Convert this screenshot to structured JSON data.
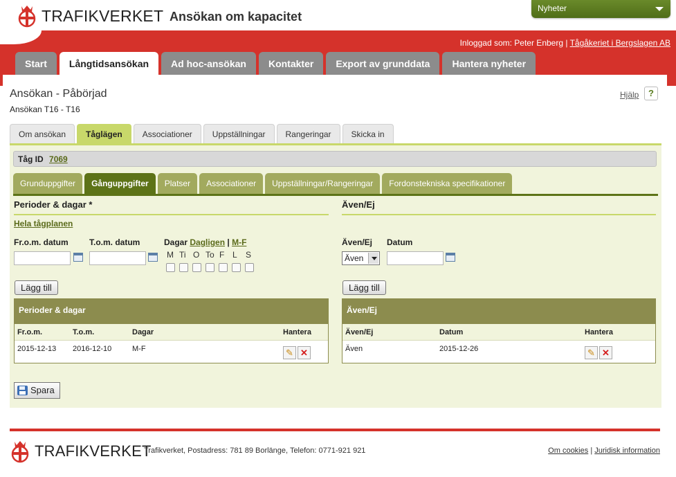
{
  "header": {
    "logo_text": "TRAFIKVERKET",
    "app_title": "Ansökan om kapacitet",
    "news_label": "Nyheter"
  },
  "login": {
    "prefix": "Inloggad som: Peter Enberg | ",
    "company": "Tågåkeriet i Bergslagen AB"
  },
  "main_tabs": [
    "Start",
    "Långtidsansökan",
    "Ad hoc-ansökan",
    "Kontakter",
    "Export av grunddata",
    "Hantera nyheter"
  ],
  "page": {
    "title": "Ansökan - Påbörjad",
    "subtitle": "Ansökan T16 - T16",
    "help_label": "Hjälp",
    "help_icon": "?"
  },
  "sub_tabs": [
    "Om ansökan",
    "Tåglägen",
    "Associationer",
    "Uppställningar",
    "Rangeringar",
    "Skicka in"
  ],
  "train": {
    "label": "Tåg ID",
    "id": "7069"
  },
  "inner_tabs": [
    "Grunduppgifter",
    "Gånguppgifter",
    "Platser",
    "Associationer",
    "Uppställningar/Rangeringar",
    "Fordonstekniska specifikationer"
  ],
  "periods": {
    "section_title": "Perioder & dagar *",
    "whole_plan_link": "Hela tågplanen",
    "from_label": "Fr.o.m. datum",
    "to_label": "T.o.m. datum",
    "days_label": "Dagar",
    "daily_link": "Dagligen",
    "separator": "|",
    "weekday_link": "M-F",
    "day_letters": [
      "M",
      "Ti",
      "O",
      "To",
      "F",
      "L",
      "S"
    ],
    "add_button": "Lägg till",
    "grid_title": "Perioder & dagar",
    "columns": [
      "Fr.o.m.",
      "T.o.m.",
      "Dagar",
      "Hantera"
    ],
    "rows": [
      {
        "from": "2015-12-13",
        "to": "2016-12-10",
        "days": "M-F"
      }
    ]
  },
  "also": {
    "section_title": "Även/Ej",
    "type_label": "Även/Ej",
    "date_label": "Datum",
    "type_value": "Även",
    "add_button": "Lägg till",
    "grid_title": "Även/Ej",
    "columns": [
      "Även/Ej",
      "Datum",
      "Hantera"
    ],
    "rows": [
      {
        "type": "Även",
        "date": "2015-12-26"
      }
    ]
  },
  "save_button": "Spara",
  "footer": {
    "logo_text": "TRAFIKVERKET",
    "address": "Trafikverket, Postadress: 781 89 Borlänge, Telefon: 0771-921 921",
    "cookies_link": "Om cookies",
    "separator": "|",
    "legal_link": "Juridisk information"
  },
  "colors": {
    "brand_red": "#d5322b",
    "olive_dark": "#5d7317",
    "olive_light": "#c8d86a",
    "panel_bg": "#f1f4dc"
  },
  "icons": [
    "crown-logo-icon",
    "calendar-icon",
    "edit-icon",
    "delete-icon",
    "save-icon",
    "chevron-down-icon",
    "help-icon"
  ]
}
